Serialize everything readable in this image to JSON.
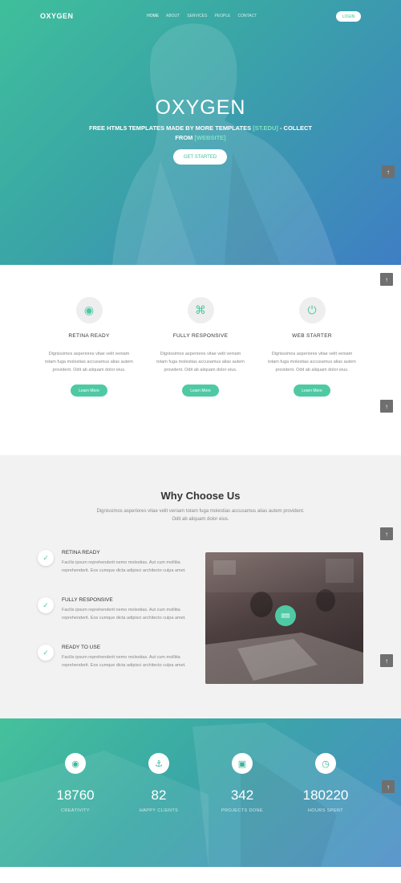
{
  "nav": {
    "logo": "OXYGEN",
    "menu": [
      "HOME",
      "ABOUT",
      "SERVICES",
      "PEOPLE",
      "CONTACT"
    ],
    "login": "LOGIN"
  },
  "hero": {
    "title": "OXYGEN",
    "subtitle_pre": "FREE HTML5 TEMPLATES MADE BY MORE TEMPLATES",
    "subtitle_highlight1": "[ST.EDU]",
    "subtitle_mid": " - COLLECT FROM ",
    "subtitle_highlight2": "[WEBSITE]",
    "button": "GET STARTED"
  },
  "totop_glyph": "↑",
  "features": [
    {
      "icon": "eye-icon",
      "glyph": "◉",
      "title": "RETINA READY",
      "text": "Dignissimos asperiores vitae velit veniam totam fuga molestias accusamus alias autem provident. Odit ab aliquam dolor eius.",
      "button": "Learn More"
    },
    {
      "icon": "command-icon",
      "glyph": "⌘",
      "title": "FULLY RESPONSIVE",
      "text": "Dignissimos asperiores vitae velit veniam totam fuga molestias accusamus alias autem provident. Odit ab aliquam dolor eius.",
      "button": "Learn More"
    },
    {
      "icon": "power-icon",
      "glyph": "⏻",
      "title": "WEB STARTER",
      "text": "Dignissimos asperiores vitae velit veniam totam fuga molestias accusamus alias autem provident. Odit ab aliquam dolor eius.",
      "button": "Learn More"
    }
  ],
  "why": {
    "title": "Why Choose Us",
    "subtitle": "Dignissimos asperiores vitae velit veniam totam fuga molestias accusamus alias autem provident. Odit ab aliquam dolor eius.",
    "items": [
      {
        "title": "RETINA READY",
        "text": "Facilis ipsum reprehenderit nemo molestias. Aut cum mollitia reprehenderit. Eos cumque dicta adipisci architecto culpa amet."
      },
      {
        "title": "FULLY RESPONSIVE",
        "text": "Facilis ipsum reprehenderit nemo molestias. Aut cum mollitia reprehenderit. Eos cumque dicta adipisci architecto culpa amet."
      },
      {
        "title": "READY TO USE",
        "text": "Facilis ipsum reprehenderit nemo molestias. Aut cum mollitia reprehenderit. Eos cumque dicta adipisci architecto culpa amet."
      }
    ],
    "check_glyph": "✓",
    "play_glyph": "🎟"
  },
  "stats": [
    {
      "icon": "eye-icon",
      "glyph": "◉",
      "number": "18760",
      "label": "CREATIVITY"
    },
    {
      "icon": "anchor-icon",
      "glyph": "⚓",
      "number": "82",
      "label": "HAPPY CLIENTS"
    },
    {
      "icon": "briefcase-icon",
      "glyph": "▣",
      "number": "342",
      "label": "PROJECTS DONE"
    },
    {
      "icon": "clock-icon",
      "glyph": "◷",
      "number": "180220",
      "label": "HOURS SPENT"
    }
  ],
  "colors": {
    "accent": "#4ec9a4",
    "hero_start": "#3fbf9b",
    "hero_end": "#3f7ec4",
    "dark_button": "#6f6f6f"
  }
}
